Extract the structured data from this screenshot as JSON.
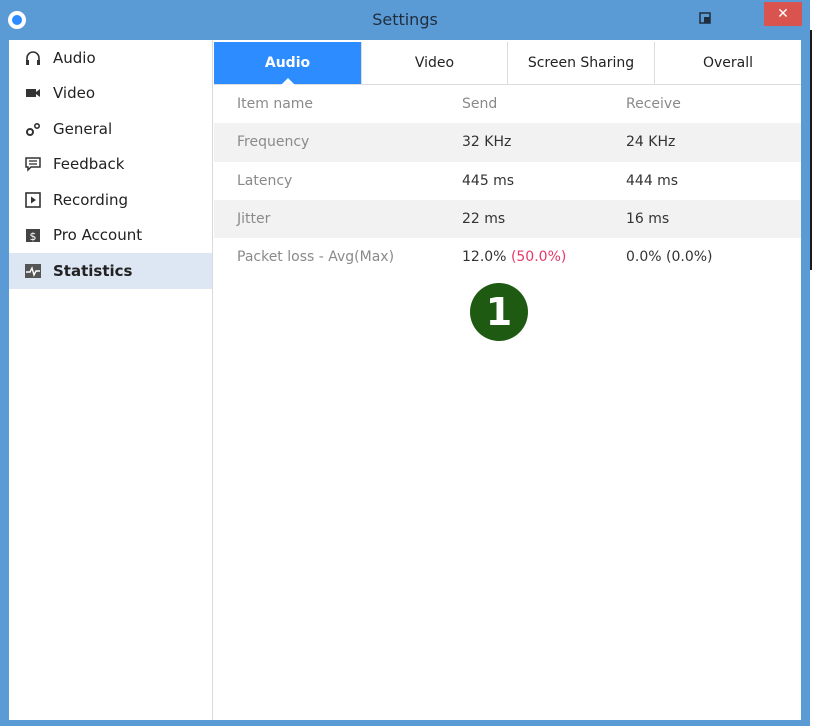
{
  "window": {
    "title": "Settings",
    "close_label": "✕",
    "pin_label": "⧉"
  },
  "sidebar": {
    "items": [
      {
        "label": "Audio",
        "icon": "headphones-icon"
      },
      {
        "label": "Video",
        "icon": "video-camera-icon"
      },
      {
        "label": "General",
        "icon": "gears-icon"
      },
      {
        "label": "Feedback",
        "icon": "chat-bubble-icon"
      },
      {
        "label": "Recording",
        "icon": "play-box-icon"
      },
      {
        "label": "Pro Account",
        "icon": "dollar-badge-icon"
      },
      {
        "label": "Statistics",
        "icon": "pulse-chart-icon",
        "active": true
      }
    ]
  },
  "tabs": [
    {
      "label": "Audio",
      "active": true
    },
    {
      "label": "Video"
    },
    {
      "label": "Screen Sharing"
    },
    {
      "label": "Overall"
    }
  ],
  "stats_table": {
    "headers": {
      "name": "Item name",
      "send": "Send",
      "receive": "Receive"
    },
    "rows": [
      {
        "name": "Frequency",
        "send": "32 KHz",
        "receive": "24 KHz"
      },
      {
        "name": "Latency",
        "send": "445 ms",
        "receive": "444 ms"
      },
      {
        "name": "Jitter",
        "send": "22 ms",
        "receive": "16 ms"
      },
      {
        "name": "Packet loss - Avg(Max)",
        "send": "12.0%",
        "send_max": "(50.0%)",
        "receive": "0.0% (0.0%)"
      }
    ]
  },
  "annotation": {
    "label": "1",
    "color": "#1e5a12"
  },
  "colors": {
    "accent": "#2d8cff",
    "titlebar": "#5b9bd5",
    "close": "#d9534f",
    "highlight_red": "#e5386b"
  }
}
